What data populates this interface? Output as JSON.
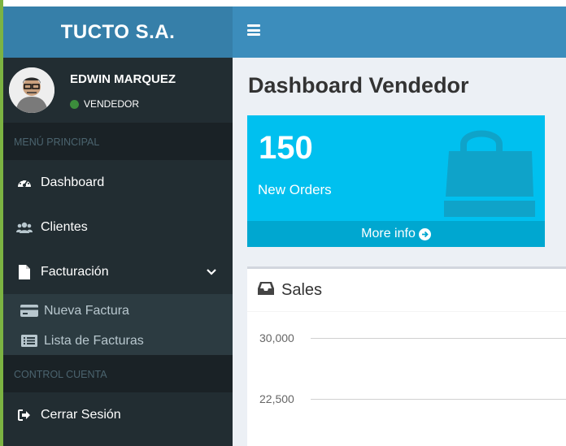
{
  "sidebar": {
    "brand": "TUCTO S.A.",
    "user": {
      "name": "EDWIN MARQUEZ",
      "role": "VENDEDOR"
    },
    "headers": [
      "MENÚ PRINCIPAL",
      "CONTROL CUENTA"
    ],
    "items": [
      {
        "label": "Dashboard",
        "icon": "dashboard-icon"
      },
      {
        "label": "Clientes",
        "icon": "users-icon"
      },
      {
        "label": "Facturación",
        "icon": "file-icon"
      },
      {
        "label": "Cerrar Sesión",
        "icon": "sign-out-icon"
      }
    ],
    "subitems": [
      {
        "label": "Nueva Factura",
        "icon": "credit-card-icon"
      },
      {
        "label": "Lista de Facturas",
        "icon": "list-icon"
      }
    ]
  },
  "navbar": {
    "toggle_icon": "hamburger-icon"
  },
  "page": {
    "title": "Dashboard Vendedor"
  },
  "stat_box": {
    "value": "150",
    "label": "New Orders",
    "footer": "More info",
    "icon": "shopping-bag-icon",
    "color": "#00c0ef"
  },
  "sales": {
    "title": "Sales",
    "icon": "inbox-icon",
    "chart_data": {
      "type": "line",
      "title": "Sales",
      "y_ticks": [
        "30,000",
        "22,500"
      ]
    }
  },
  "colors": {
    "brand": "#367fa9",
    "navbar": "#3c8dbc",
    "sidebar": "#222d32",
    "accent": "#00c0ef"
  }
}
